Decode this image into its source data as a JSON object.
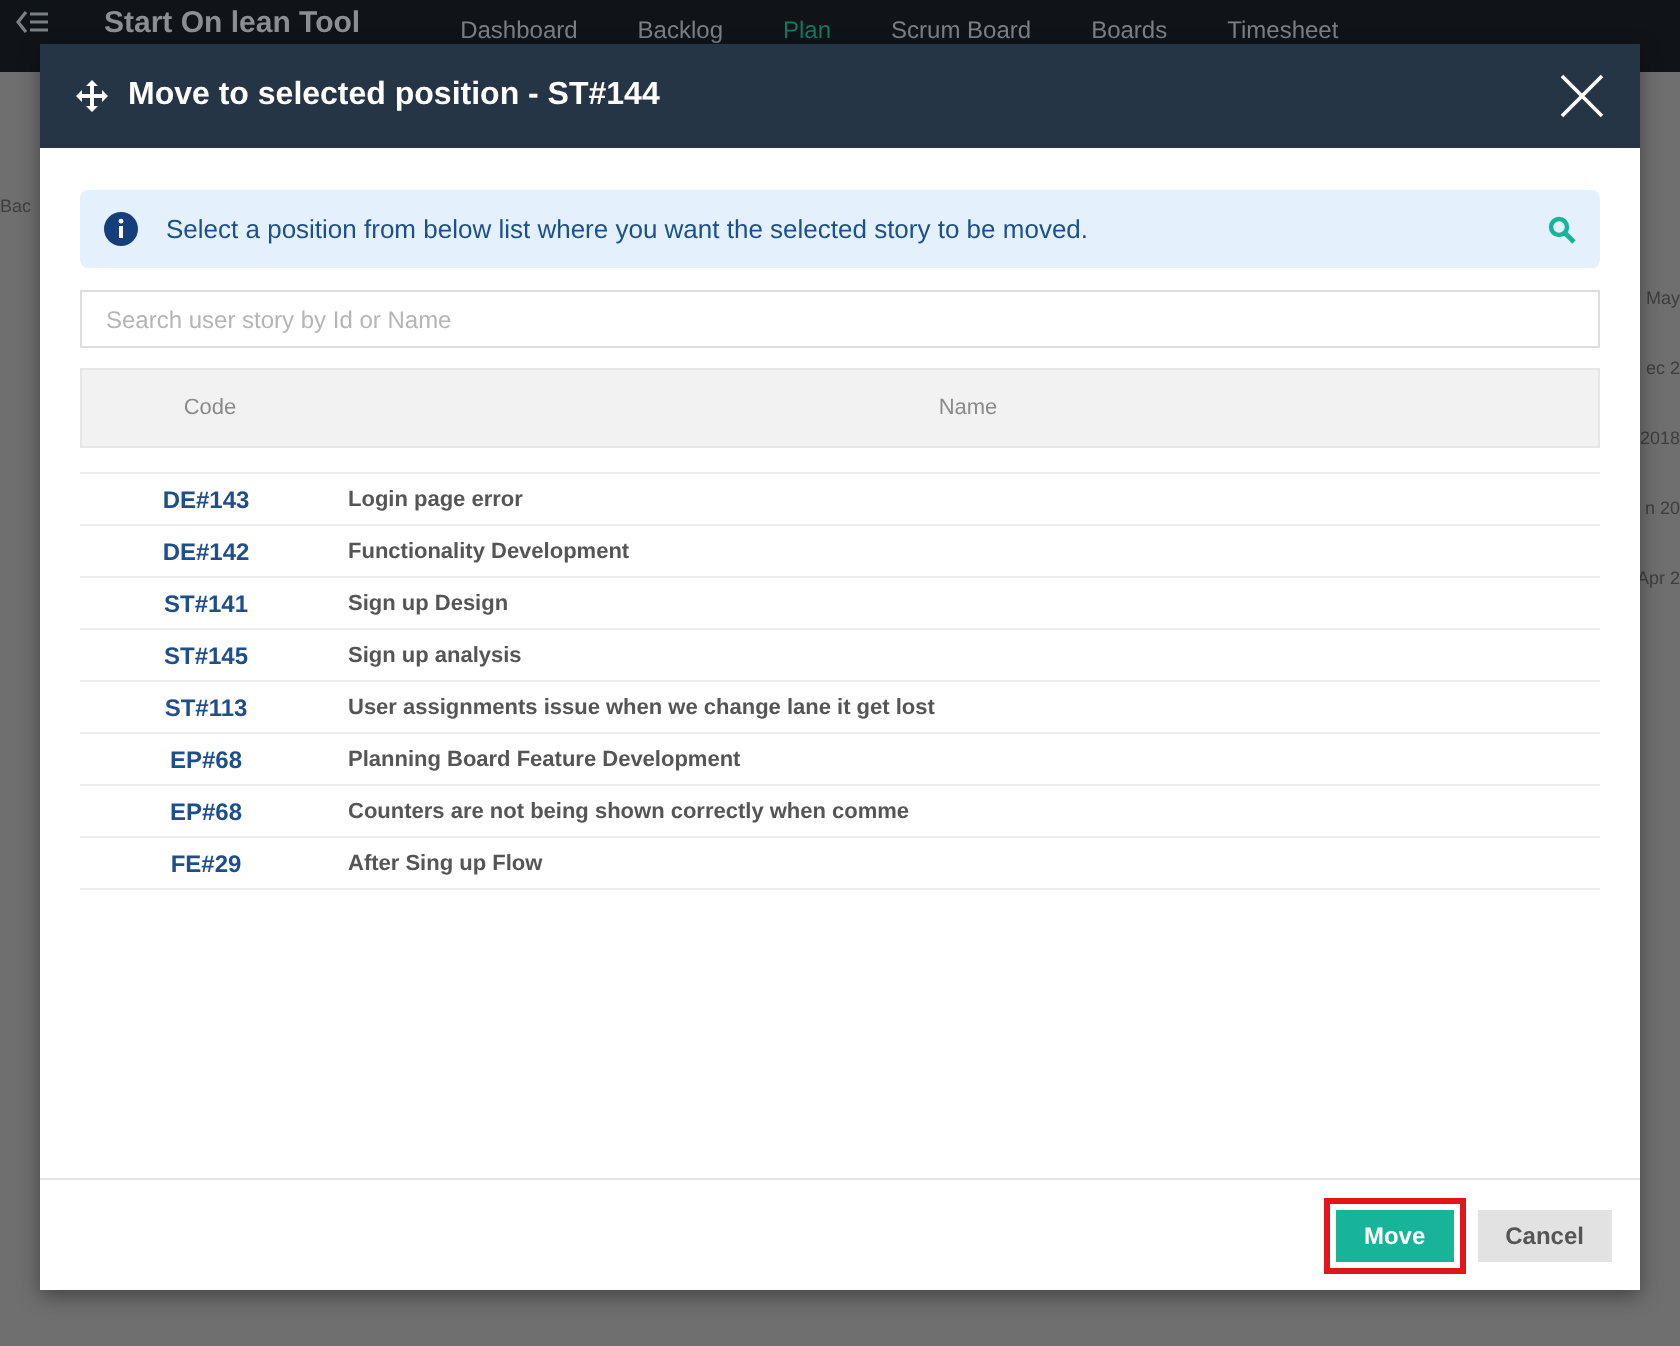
{
  "app": {
    "title": "Start On lean Tool",
    "nav": [
      {
        "label": "Dashboard",
        "selected": false
      },
      {
        "label": "Backlog",
        "selected": false
      },
      {
        "label": "Plan",
        "selected": true
      },
      {
        "label": "Scrum Board",
        "selected": false
      },
      {
        "label": "Boards",
        "selected": false
      },
      {
        "label": "Timesheet",
        "selected": false
      }
    ],
    "left_fragments": [
      "Bac"
    ],
    "right_fragments": [
      "May",
      "ec 2",
      "2018",
      "n 20",
      "Apr 2"
    ]
  },
  "dialog": {
    "title": "Move to selected position - ST#144",
    "info": "Select a position from below list where you want the selected story to be moved.",
    "search": {
      "placeholder": "Search user story by Id or Name"
    },
    "columns": [
      "Code",
      "Name"
    ],
    "rows": [
      {
        "code": "DE#143",
        "name": "Login page error"
      },
      {
        "code": "DE#142",
        "name": "Functionality Development"
      },
      {
        "code": "ST#141",
        "name": "Sign up Design"
      },
      {
        "code": "ST#145",
        "name": "Sign up analysis"
      },
      {
        "code": "ST#113",
        "name": "User assignments issue when we change lane it get lost"
      },
      {
        "code": "EP#68",
        "name": "Planning Board Feature Development"
      },
      {
        "code": "EP#68",
        "name": "Counters are not being shown correctly when comme"
      },
      {
        "code": "FE#29",
        "name": "After Sing up Flow"
      }
    ],
    "buttons": [
      {
        "label": "Move",
        "kind": "primary",
        "highlighted": true
      },
      {
        "label": "Cancel",
        "kind": "secondary",
        "highlighted": false
      }
    ]
  }
}
